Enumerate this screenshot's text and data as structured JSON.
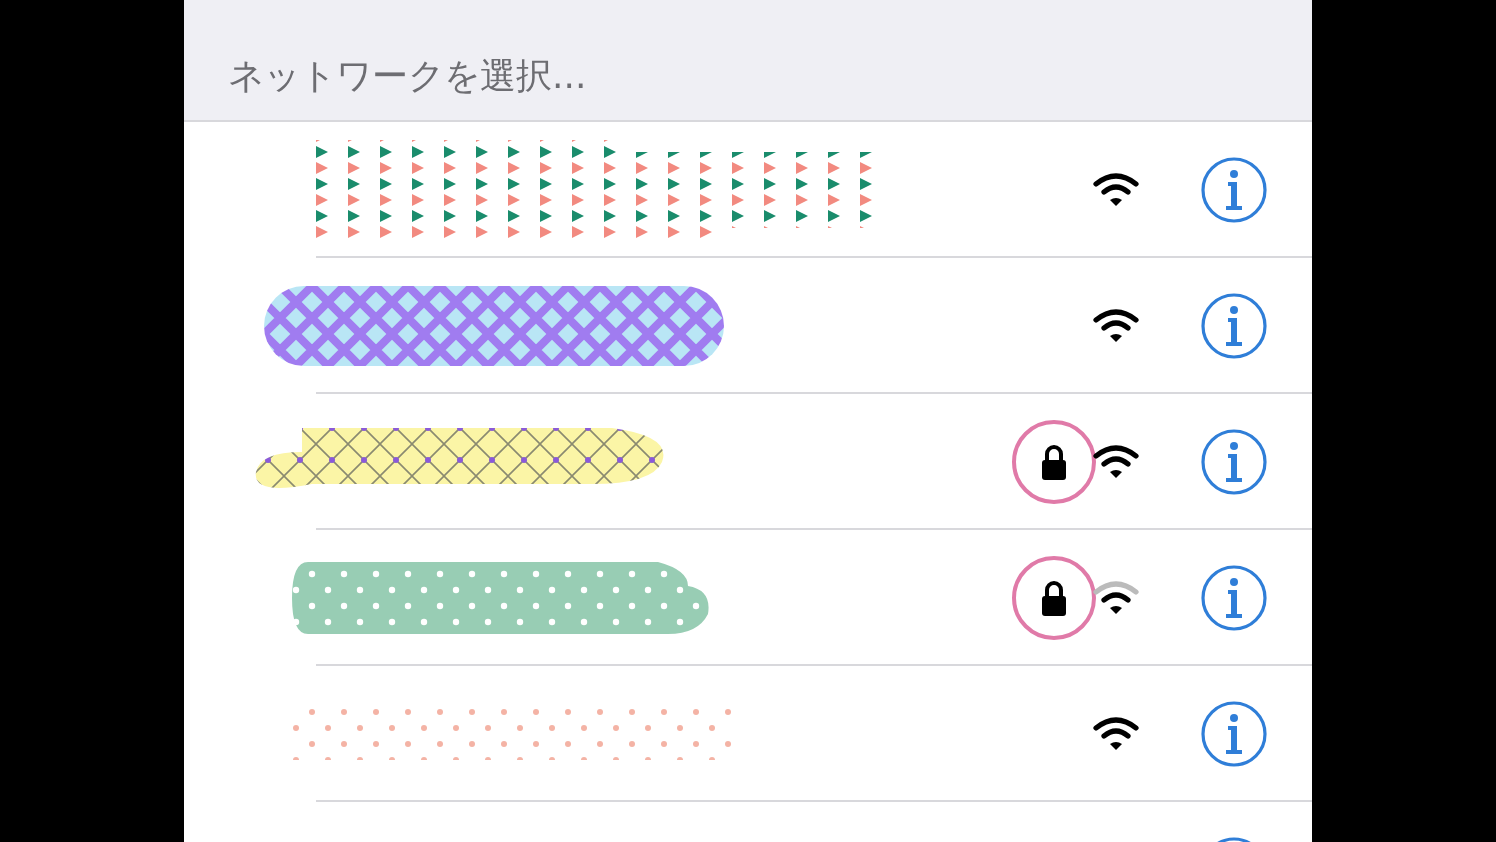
{
  "header": {
    "title": "ネットワークを選択..."
  },
  "networks": [
    {
      "kind": "triangles",
      "locked": false,
      "weak_signal": false
    },
    {
      "kind": "plaid",
      "locked": false,
      "weak_signal": false
    },
    {
      "kind": "crosshatch",
      "locked": true,
      "weak_signal": false
    },
    {
      "kind": "green-dots",
      "locked": true,
      "weak_signal": true
    },
    {
      "kind": "pink-dots",
      "locked": false,
      "weak_signal": false
    },
    {
      "kind": "none"
    }
  ]
}
